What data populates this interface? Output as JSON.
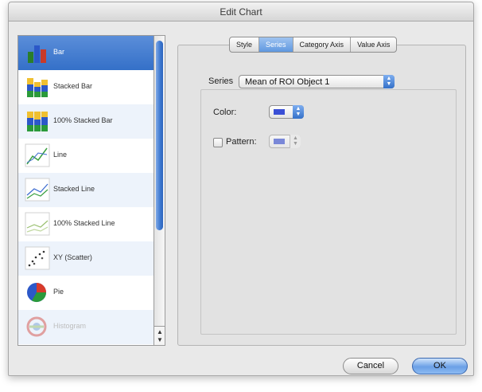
{
  "window": {
    "title": "Edit Chart"
  },
  "chart_types": [
    {
      "label": "Bar",
      "icon": "bar-chart-icon",
      "selected": true
    },
    {
      "label": "Stacked Bar",
      "icon": "stacked-bar-icon"
    },
    {
      "label": "100% Stacked Bar",
      "icon": "percent-stacked-bar-icon"
    },
    {
      "label": "Line",
      "icon": "line-chart-icon"
    },
    {
      "label": "Stacked Line",
      "icon": "stacked-line-icon"
    },
    {
      "label": "100% Stacked Line",
      "icon": "percent-stacked-line-icon"
    },
    {
      "label": "XY (Scatter)",
      "icon": "scatter-chart-icon"
    },
    {
      "label": "Pie",
      "icon": "pie-chart-icon"
    },
    {
      "label": "Histogram",
      "icon": "histogram-icon",
      "disabled": true
    }
  ],
  "tabs": [
    {
      "label": "Style"
    },
    {
      "label": "Series",
      "active": true
    },
    {
      "label": "Category Axis"
    },
    {
      "label": "Value Axis"
    }
  ],
  "series_panel": {
    "series_label": "Series",
    "series_value": "Mean of ROI Object 1",
    "color_label": "Color:",
    "pattern_label": "Pattern:",
    "pattern_checked": false,
    "swatch_color": "#3a4fd6"
  },
  "buttons": {
    "cancel": "Cancel",
    "ok": "OK"
  },
  "colors": {
    "selection": "#3470c8",
    "accent": "#5f98e0"
  }
}
